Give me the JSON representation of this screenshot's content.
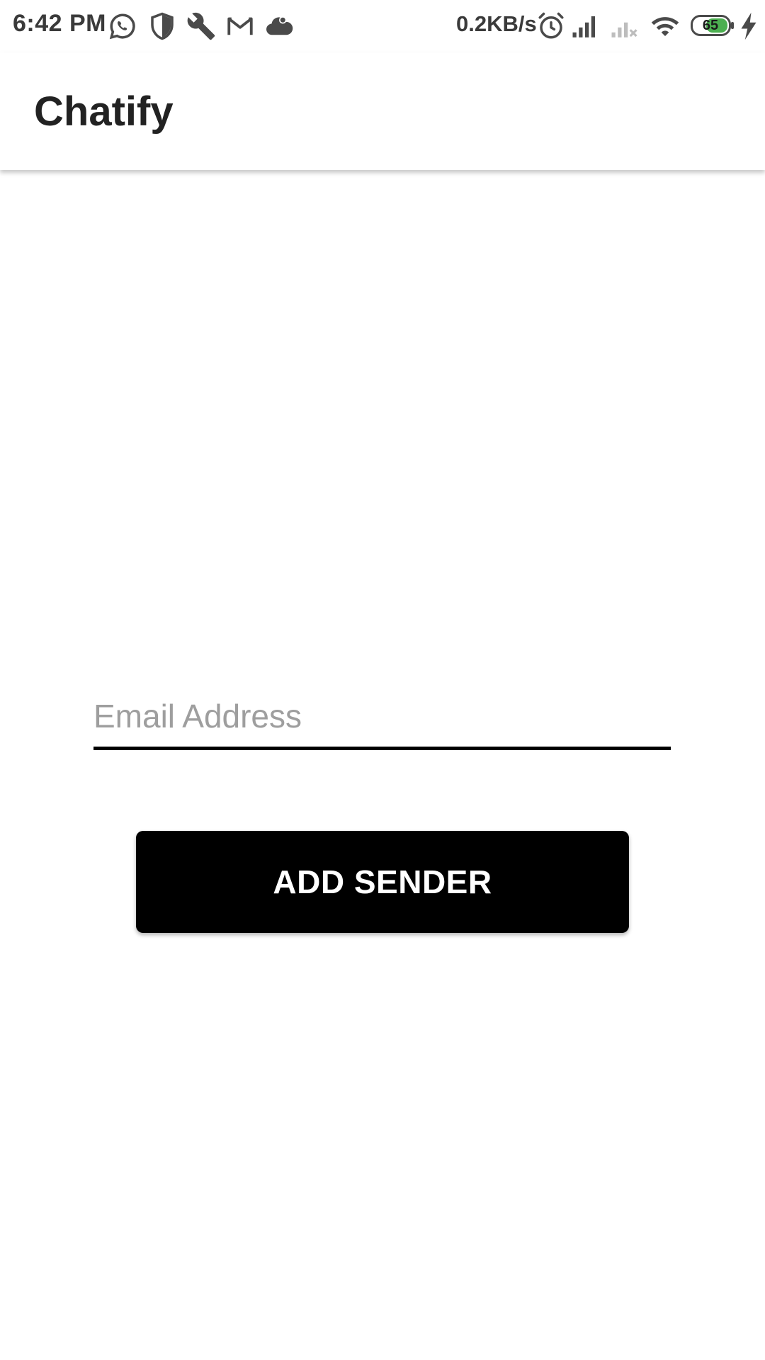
{
  "status_bar": {
    "time": "6:42 PM",
    "network_speed": "0.2KB/s",
    "battery_level": "65",
    "notification_icons": [
      "whatsapp-icon",
      "shield-icon",
      "wrench-icon",
      "gmail-icon",
      "cloud-icon"
    ],
    "system_icons": [
      "alarm-icon",
      "signal-icon",
      "no-signal-icon",
      "wifi-icon",
      "battery-icon",
      "charging-icon"
    ],
    "battery_color": "#4caf50"
  },
  "app_bar": {
    "title": "Chatify"
  },
  "form": {
    "email_placeholder": "Email Address",
    "email_value": "",
    "add_button_label": "ADD SENDER"
  },
  "colors": {
    "background": "#ffffff",
    "button_background": "#000000",
    "button_text": "#ffffff",
    "input_underline": "#000000",
    "placeholder": "#9e9e9e"
  }
}
